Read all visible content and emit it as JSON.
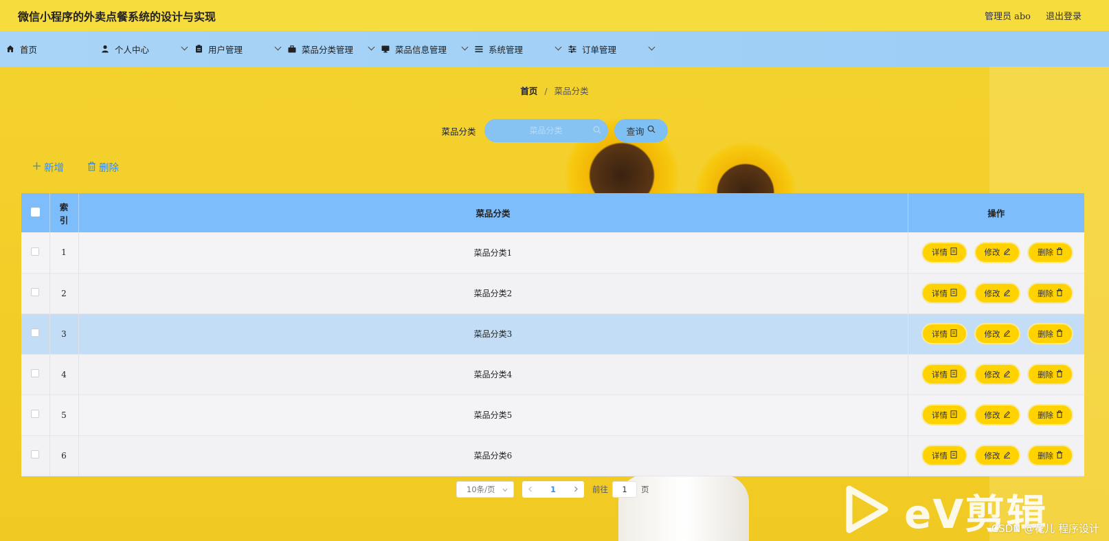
{
  "header": {
    "title": "微信小程序的外卖点餐系统的设计与实现",
    "user_label": "管理员 abo",
    "logout_label": "退出登录"
  },
  "nav": {
    "items": [
      {
        "label": "首页",
        "icon": "home-icon"
      },
      {
        "label": "个人中心",
        "icon": "user-icon"
      },
      {
        "label": "用户管理",
        "icon": "clipboard-icon"
      },
      {
        "label": "菜品分类管理",
        "icon": "briefcase-icon"
      },
      {
        "label": "菜品信息管理",
        "icon": "monitor-icon"
      },
      {
        "label": "系统管理",
        "icon": "list-icon"
      },
      {
        "label": "订单管理",
        "icon": "sliders-icon"
      }
    ]
  },
  "breadcrumb": {
    "home": "首页",
    "separator": "/",
    "current": "菜品分类"
  },
  "search": {
    "label": "菜品分类",
    "placeholder": "菜品分类",
    "button_label": "查询"
  },
  "actions": {
    "add_label": "新增",
    "delete_label": "删除"
  },
  "table": {
    "columns": [
      "索引",
      "菜品分类",
      "操作"
    ],
    "index_header_line1": "索",
    "index_header_line2": "引",
    "rows": [
      {
        "index": "1",
        "category": "菜品分类1"
      },
      {
        "index": "2",
        "category": "菜品分类2"
      },
      {
        "index": "3",
        "category": "菜品分类3"
      },
      {
        "index": "4",
        "category": "菜品分类4"
      },
      {
        "index": "5",
        "category": "菜品分类5"
      },
      {
        "index": "6",
        "category": "菜品分类6"
      }
    ],
    "highlighted_row": 3,
    "op_labels": {
      "detail": "详情",
      "edit": "修改",
      "delete": "删除"
    }
  },
  "pagination": {
    "page_size": "10条/页",
    "current_page": "1",
    "goto_label": "前往",
    "goto_value": "1",
    "page_unit": "页"
  },
  "watermark": {
    "brand": "eV剪辑",
    "credit": "CSDN @花儿 程序设计"
  },
  "colors": {
    "accent_yellow": "#ffd200",
    "nav_blue": "#a9d4f7",
    "table_header_blue": "#7dbdfb",
    "link_blue": "#3a8ee6"
  }
}
